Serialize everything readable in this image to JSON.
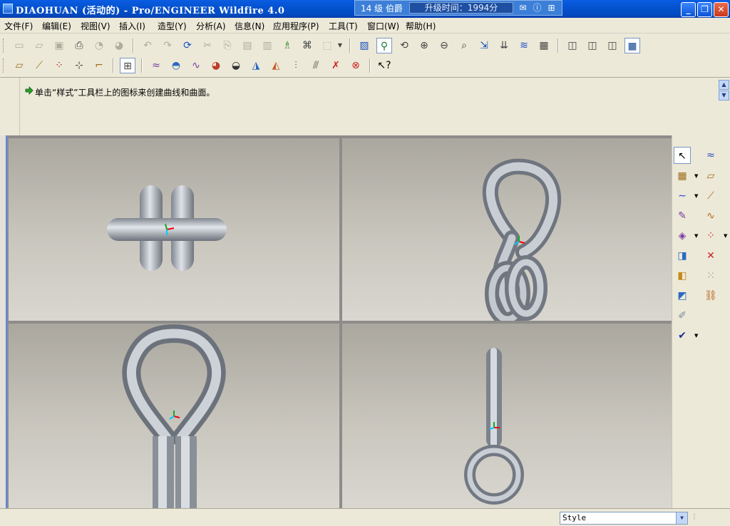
{
  "window": {
    "title": "DIAOHUAN (活动的) - Pro/ENGINEER Wildfire 4.0",
    "rank_level": "14 级 伯爵",
    "upgrade_timer": "升级时间：1994分",
    "controls": [
      "minimize",
      "maximize",
      "close"
    ]
  },
  "menu": [
    "文件(F)",
    "编辑(E)",
    "视图(V)",
    "插入(I)",
    "造型(Y)",
    "分析(A)",
    "信息(N)",
    "应用程序(P)",
    "工具(T)",
    "窗口(W)",
    "帮助(H)"
  ],
  "toolbar_row1": [
    "new-icon",
    "open-icon",
    "save-icon",
    "print-icon",
    "send-mail-icon",
    "send-mail2-icon",
    "undo-icon",
    "redo-icon",
    "regenerate-icon",
    "cut-icon",
    "copy-icon",
    "paste-icon",
    "paste-special-icon",
    "regen-manager-icon",
    "find-icon",
    "select-box-icon",
    "repaint-icon",
    "spin-center-icon",
    "orient-mode-icon",
    "zoom-in-icon",
    "zoom-out-icon",
    "refit-icon",
    "reorient-icon",
    "saved-views-icon",
    "layers-icon",
    "view-manager-icon",
    "wireframe-icon",
    "hidden-line-icon",
    "no-hidden-icon",
    "shading-icon"
  ],
  "toolbar_row2": [
    "datum-plane-icon",
    "datum-axis-icon",
    "datum-point-icon",
    "coord-sys-icon",
    "datum-display-icon",
    "four-view-icon",
    "curvature-icon",
    "section-icon",
    "offset-icon",
    "gaussian-icon",
    "reflection-icon",
    "shade-icon",
    "draft-icon",
    "slope-icon",
    "dihedral-icon",
    "delete-analysis-icon",
    "hide-analysis-icon",
    "help-pointer-icon"
  ],
  "message": {
    "text": "单击“样式”工具栏上的图标来创建曲线和曲面。"
  },
  "right_toolbar": [
    "select-icon",
    "sketch-curve-icon",
    "active-plane-icon",
    "internal-plane-icon",
    "curve-icon",
    "cos-curve-icon",
    "edit-curve-icon",
    "free-curve-icon",
    "surface-icon",
    "curve-point-icon",
    "surface-connect-icon",
    "trim-icon",
    "surface-trim-icon",
    "point-set-icon",
    "surface-edit-icon",
    "curve-link-icon",
    "pen-icon",
    "done-icon"
  ],
  "status": {
    "filter_value": "Style"
  },
  "colors": {
    "titlebar": "#0453d0",
    "viewport_top": "#aaa79f",
    "viewport_bottom": "#d9d7cf",
    "model_grey": "#b7bdc5",
    "split_line": "#f4f4f2"
  }
}
